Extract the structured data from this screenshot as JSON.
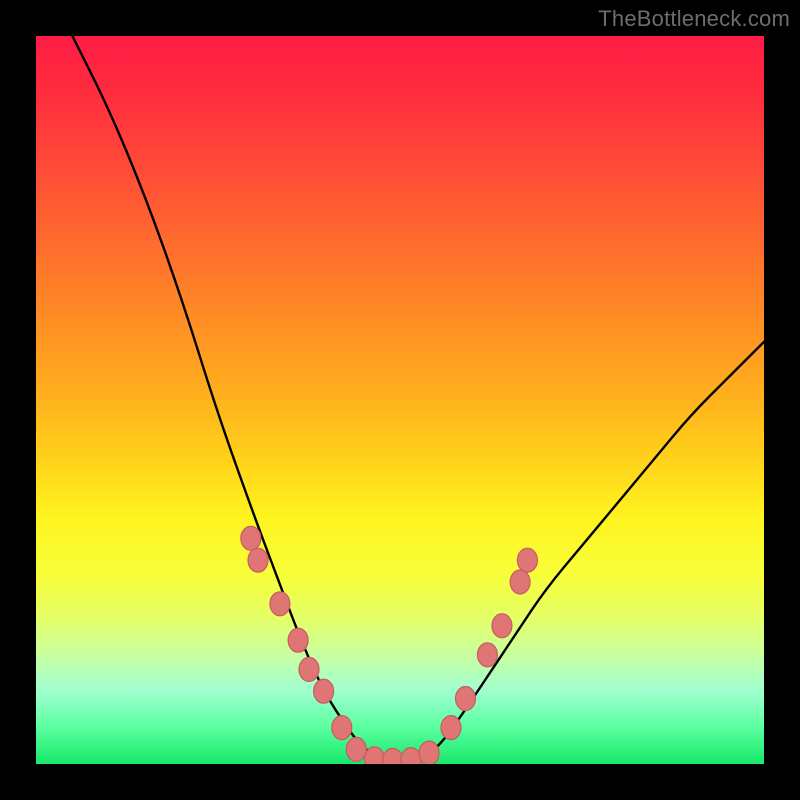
{
  "watermark": "TheBottleneck.com",
  "chart_data": {
    "type": "line",
    "title": "",
    "xlabel": "",
    "ylabel": "",
    "xlim": [
      0,
      100
    ],
    "ylim": [
      0,
      100
    ],
    "grid": false,
    "legend": false,
    "series": [
      {
        "name": "bottleneck-curve",
        "x": [
          5,
          10,
          15,
          20,
          25,
          30,
          33,
          36,
          39,
          42,
          45,
          48,
          52,
          55,
          58,
          62,
          66,
          70,
          75,
          80,
          85,
          90,
          95,
          100
        ],
        "y": [
          100,
          90,
          78,
          64,
          48,
          34,
          26,
          18,
          11,
          6,
          2,
          0.5,
          0.5,
          2,
          6,
          12,
          18,
          24,
          30,
          36,
          42,
          48,
          53,
          58
        ]
      }
    ],
    "markers": [
      {
        "x": 29.5,
        "y": 31
      },
      {
        "x": 30.5,
        "y": 28
      },
      {
        "x": 33.5,
        "y": 22
      },
      {
        "x": 36.0,
        "y": 17
      },
      {
        "x": 37.5,
        "y": 13
      },
      {
        "x": 39.5,
        "y": 10
      },
      {
        "x": 42.0,
        "y": 5
      },
      {
        "x": 44.0,
        "y": 2
      },
      {
        "x": 46.5,
        "y": 0.7
      },
      {
        "x": 49.0,
        "y": 0.5
      },
      {
        "x": 51.5,
        "y": 0.6
      },
      {
        "x": 54.0,
        "y": 1.5
      },
      {
        "x": 57.0,
        "y": 5
      },
      {
        "x": 59.0,
        "y": 9
      },
      {
        "x": 62.0,
        "y": 15
      },
      {
        "x": 64.0,
        "y": 19
      },
      {
        "x": 66.5,
        "y": 25
      },
      {
        "x": 67.5,
        "y": 28
      }
    ],
    "background_gradient": {
      "top": "#ff1c45",
      "upper_mid": "#ff8a25",
      "mid": "#fff31f",
      "lower_mid": "#c9ffa0",
      "bottom": "#17e86a"
    }
  }
}
